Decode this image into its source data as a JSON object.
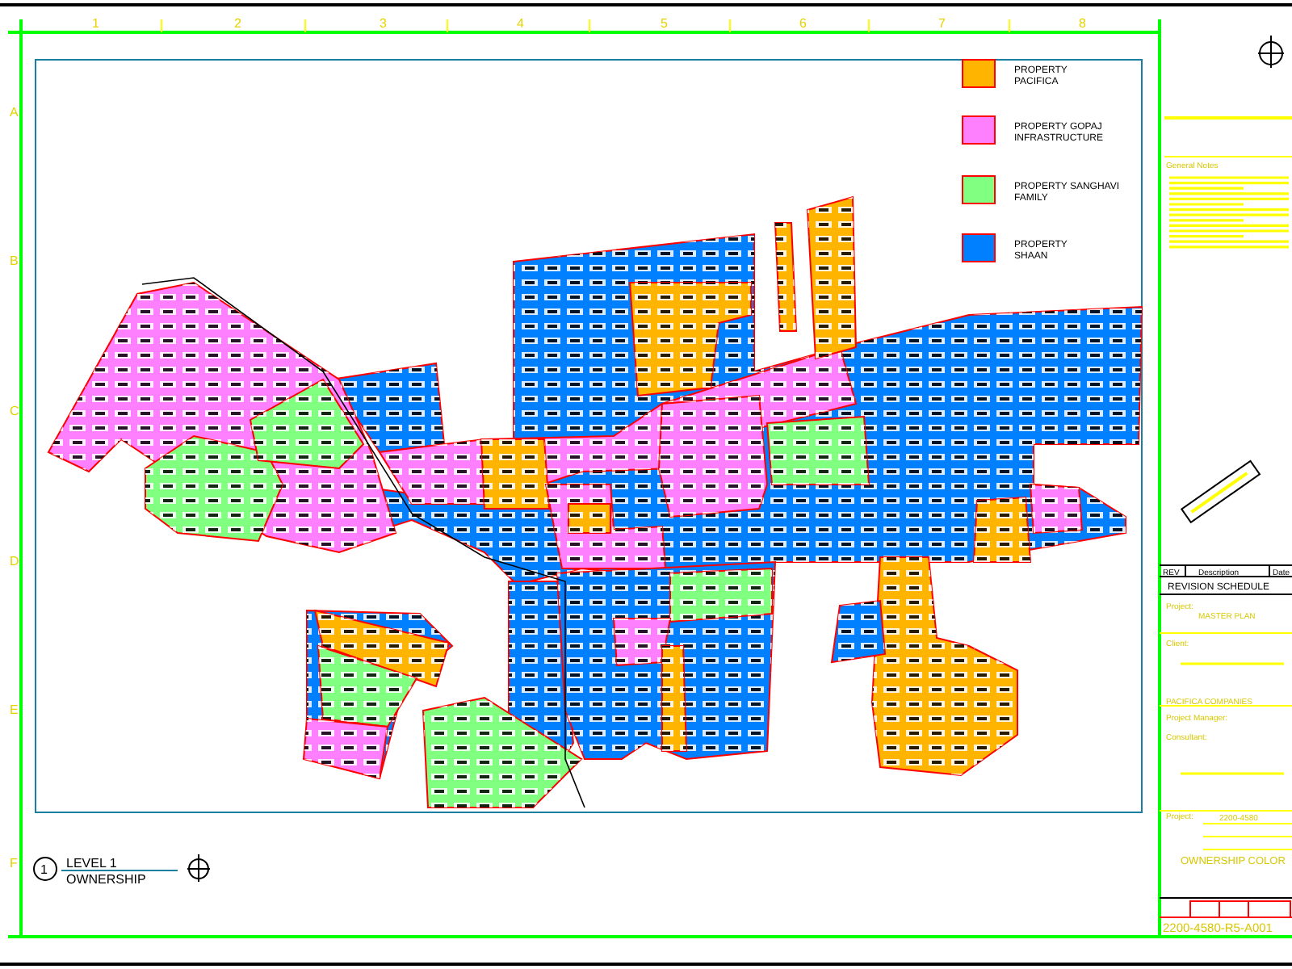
{
  "grid": {
    "columns": [
      "1",
      "2",
      "3",
      "4",
      "5",
      "6",
      "7",
      "8"
    ],
    "rows": [
      "A",
      "B",
      "C",
      "D",
      "E",
      "F"
    ]
  },
  "legend": [
    {
      "lines": [
        "PROPERTY",
        "PACIFICA"
      ],
      "color": "#ffb400"
    },
    {
      "lines": [
        "PROPERTY GOPAJ",
        "INFRASTRUCTURE"
      ],
      "color": "#ff80ff"
    },
    {
      "lines": [
        "PROPERTY SANGHAVI",
        "FAMILY"
      ],
      "color": "#80ff80"
    },
    {
      "lines": [
        "PROPERTY",
        "SHAAN"
      ],
      "color": "#0080ff"
    }
  ],
  "drawing_title": {
    "number": "1",
    "title": "LEVEL 1",
    "subtitle": "OWNERSHIP"
  },
  "title_block": {
    "notes_heading": "General Notes",
    "revision_columns": [
      "REV",
      "Description",
      "Date"
    ],
    "revision_title": "REVISION SCHEDULE",
    "project_label": "Project:",
    "project_value": "MASTER PLAN",
    "client_label": "Client:",
    "client_value": "PACIFICA COMPANIES",
    "manager_label": "Project Manager:",
    "consultant_label": "Consultant:",
    "project_number_label": "Project:",
    "project_number_value": "2200-4580",
    "sheet_name": "OWNERSHIP COLOR",
    "sheet_number": "2200-4580-R5-A001"
  }
}
